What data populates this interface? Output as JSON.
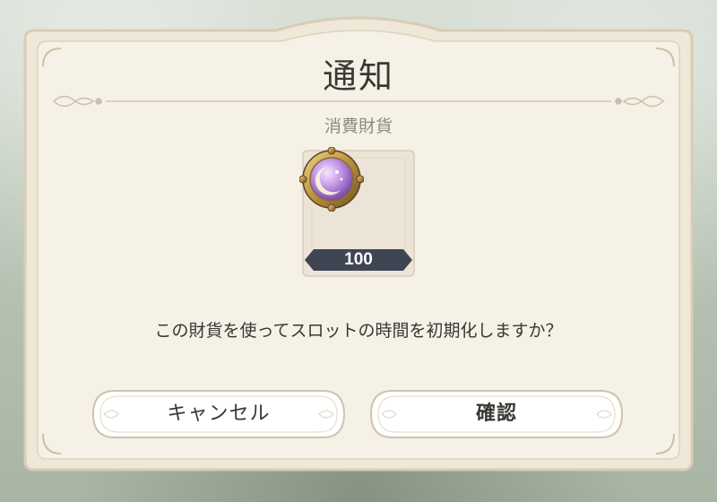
{
  "dialog": {
    "title": "通知",
    "subtitle": "消費財貨",
    "message": "この財貨を使ってスロットの時間を初期化しますか？"
  },
  "item": {
    "icon": "moon-orb-coin-icon",
    "quantity": "100"
  },
  "buttons": {
    "cancel_label": "キャンセル",
    "confirm_label": "確認"
  },
  "colors": {
    "panel": "#f4eee2",
    "frame": "#cfc3ad",
    "badge": "#3f4553",
    "orb": "#b98be0"
  }
}
